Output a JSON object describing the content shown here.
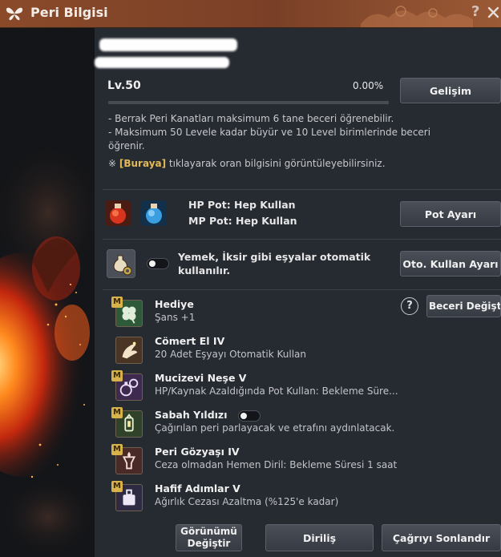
{
  "window": {
    "title": "Peri Bilgisi",
    "help_icon": "?"
  },
  "level": {
    "label": "Lv.50",
    "percent": "0.00%",
    "progress": 0.0,
    "upgrade_button": "Gelişim"
  },
  "notes": [
    "- Berrak Peri Kanatları maksimum 6 tane beceri öğrenebilir.",
    "- Maksimum 50 Levele kadar büyür ve 10 Level birimlerinde beceri",
    "öğrenir."
  ],
  "info_note": {
    "prefix": "※ ",
    "link": "[Buraya]",
    "suffix": " tıklayarak oran bilgisini görüntüleyebilirsiniz."
  },
  "pots": {
    "hp_label": "HP Pot: Hep Kullan",
    "mp_label": "MP Pot: Hep Kullan",
    "button": "Pot Ayarı",
    "hp_icon": "hp-potion-icon",
    "mp_icon": "mp-potion-icon"
  },
  "auto_use": {
    "line1": "Yemek, İksir gibi eşyalar otomatik",
    "line2": "kullanılır.",
    "button": "Oto. Kullan Ayarı",
    "icon": "potion-gear-icon"
  },
  "skills_button": "Beceri Değişt",
  "skills": [
    {
      "name": "Hediye",
      "desc": "Şans +1",
      "badge": "M",
      "icon": "clover-icon",
      "bg": "#2f5a3a"
    },
    {
      "name": "Cömert El IV",
      "desc": "20 Adet Eşyayı Otomatik Kullan",
      "badge": "",
      "icon": "fairy-hand-icon",
      "bg": "#4a3424"
    },
    {
      "name": "Mucizevi Neşe V",
      "desc": "HP/Kaynak Azaldığında Pot Kullan: Bekleme Süre...",
      "badge": "M",
      "icon": "potions-icon",
      "bg": "#3e2a4e"
    },
    {
      "name": "Sabah Yıldızı",
      "desc": "Çağırılan peri parlayacak ve etrafını aydınlatacak.",
      "badge": "M",
      "icon": "lantern-icon",
      "bg": "#30422a"
    },
    {
      "name": "Peri Gözyaşı IV",
      "desc": "Ceza olmadan Hemen Diril: Bekleme Süresi 1 saat",
      "badge": "M",
      "icon": "tear-vial-icon",
      "bg": "#4a2a26"
    },
    {
      "name": "Hafif Adımlar V",
      "desc": "Ağırlık Cezası Azaltma (%125'e kadar)",
      "badge": "M",
      "icon": "weight-icon",
      "bg": "#2e2a44"
    }
  ],
  "footer": {
    "change_view": [
      "Görünümü",
      "Değiştir"
    ],
    "revive": "Diriliş",
    "end_summon": "Çağrıyı Sonlandır"
  }
}
